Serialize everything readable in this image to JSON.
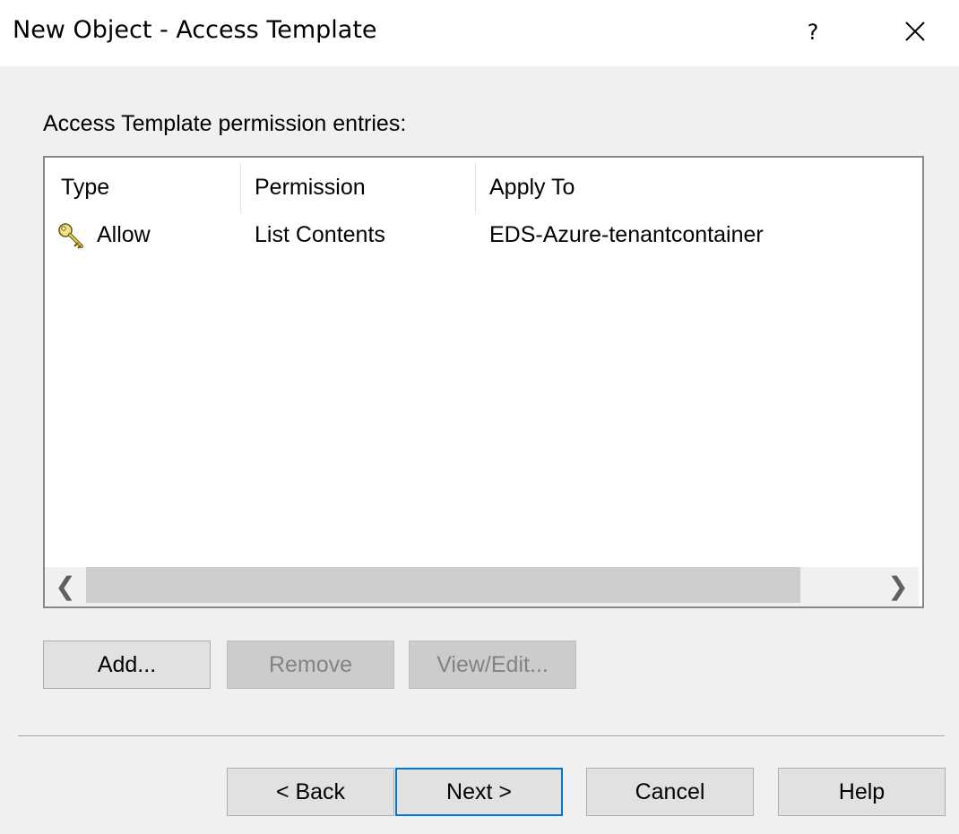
{
  "window": {
    "title": "New Object - Access Template",
    "help_glyph": "?",
    "close_icon": "close-icon"
  },
  "list": {
    "label": "Access Template permission entries:",
    "columns": [
      "Type",
      "Permission",
      "Apply To"
    ],
    "rows": [
      {
        "icon": "key-icon",
        "type": "Allow",
        "permission": "List Contents",
        "apply_to": "EDS-Azure-tenantcontainer"
      }
    ],
    "scroll_left_glyph": "❮",
    "scroll_right_glyph": "❯"
  },
  "entry_buttons": {
    "add": "Add...",
    "remove": "Remove",
    "view_edit": "View/Edit..."
  },
  "nav_buttons": {
    "back": "< Back",
    "next": "Next >",
    "cancel": "Cancel",
    "help": "Help"
  }
}
